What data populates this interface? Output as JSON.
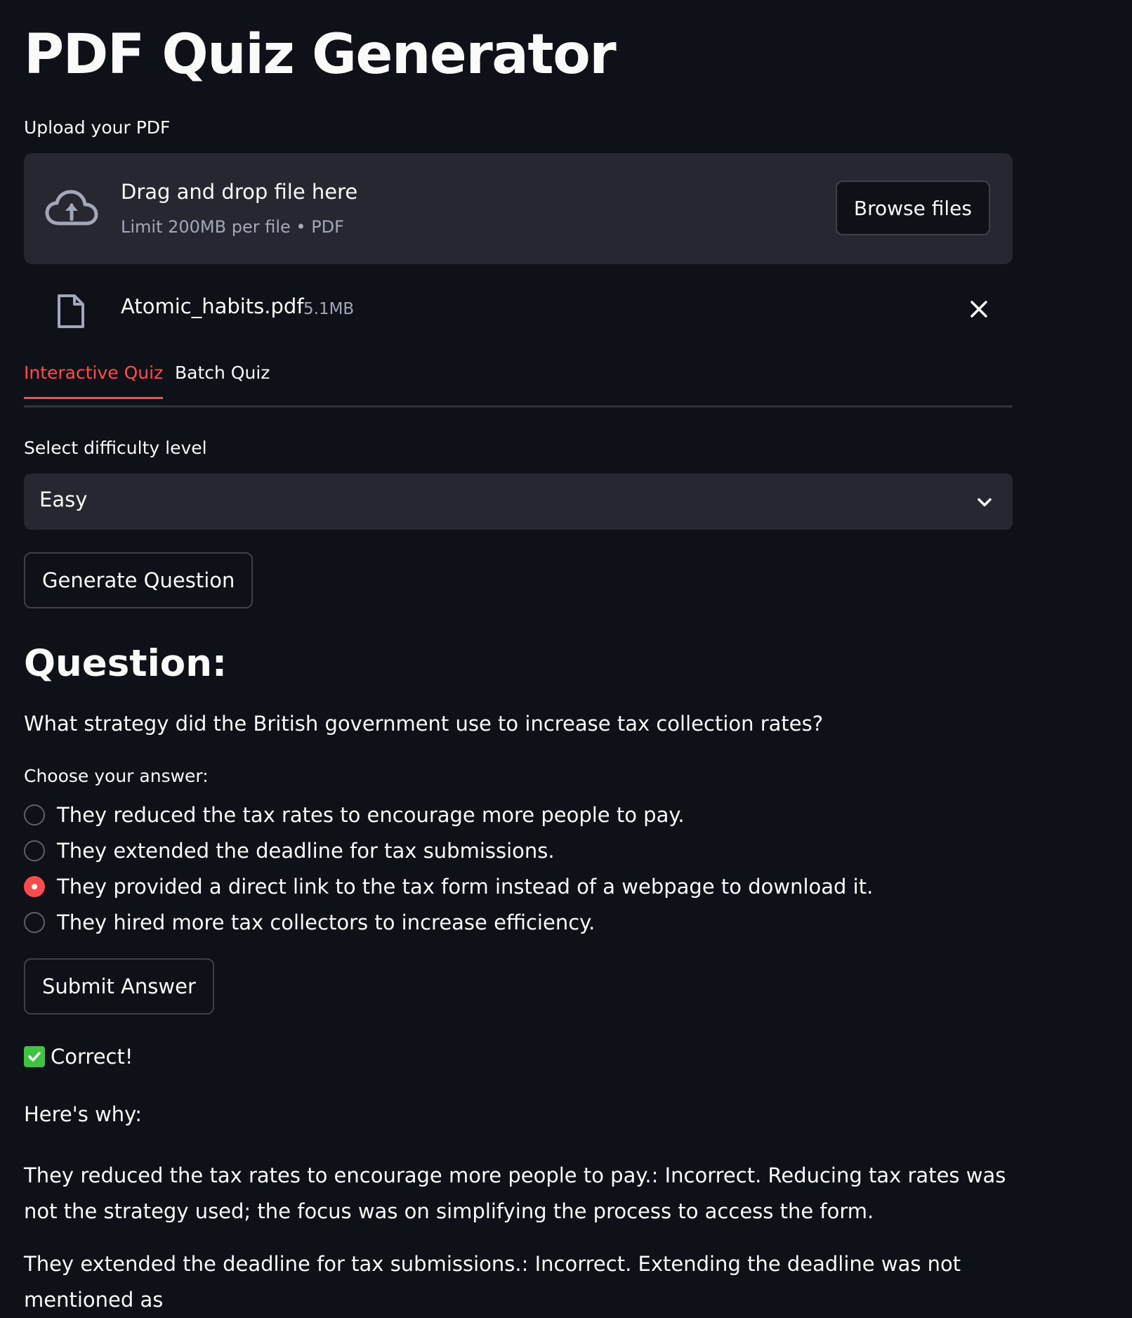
{
  "app": {
    "title": "PDF Quiz Generator"
  },
  "uploader": {
    "label": "Upload your PDF",
    "dropzone_title": "Drag and drop file here",
    "dropzone_subtitle": "Limit 200MB per file • PDF",
    "browse_label": "Browse files",
    "icon": "cloud-upload-icon",
    "file": {
      "name": "Atomic_habits.pdf",
      "size": "5.1MB",
      "icon": "file-icon"
    }
  },
  "tabs": [
    {
      "label": "Interactive Quiz",
      "active": true
    },
    {
      "label": "Batch Quiz",
      "active": false
    }
  ],
  "difficulty": {
    "label": "Select difficulty level",
    "value": "Easy"
  },
  "generate_button": "Generate Question",
  "question": {
    "heading": "Question:",
    "text": "What strategy did the British government use to increase tax collection rates?",
    "answer_label": "Choose your answer:",
    "options": [
      "They reduced the tax rates to encourage more people to pay.",
      "They extended the deadline for tax submissions.",
      "They provided a direct link to the tax form instead of a webpage to download it.",
      "They hired more tax collectors to increase efficiency."
    ],
    "selected_index": 2
  },
  "submit_button": "Submit Answer",
  "result": {
    "text": "Correct!",
    "icon": "check-mark-icon"
  },
  "explanation": {
    "heading": "Here's why:",
    "paragraphs": [
      "They reduced the tax rates to encourage more people to pay.: Incorrect. Reducing tax rates was not the strategy used; the focus was on simplifying the process to access the form.",
      "They extended the deadline for tax submissions.: Incorrect. Extending the deadline was not mentioned as"
    ]
  },
  "colors": {
    "background": "#0e1117",
    "surface": "#262730",
    "accent": "#ff4b4b",
    "success": "#3ec441",
    "muted_text": "#a3a8b8"
  }
}
